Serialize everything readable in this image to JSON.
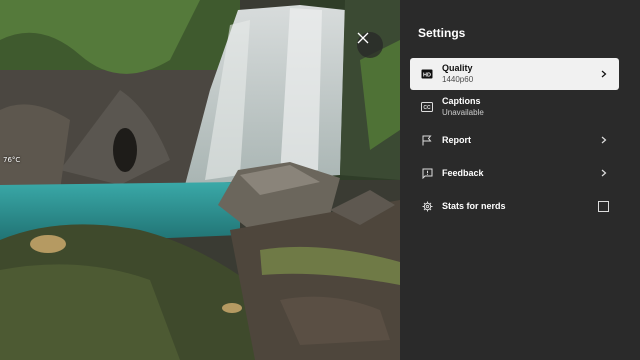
{
  "overlay": {
    "temperature": "76°C"
  },
  "settings": {
    "title": "Settings",
    "items": [
      {
        "label": "Quality",
        "sub": "1440p60",
        "icon": "hd-icon",
        "control": "chevron"
      },
      {
        "label": "Captions",
        "sub": "Unavailable",
        "icon": "closed-captions-icon",
        "control": "none"
      },
      {
        "label": "Report",
        "sub": "",
        "icon": "flag-icon",
        "control": "chevron"
      },
      {
        "label": "Feedback",
        "sub": "",
        "icon": "feedback-icon",
        "control": "chevron"
      },
      {
        "label": "Stats for nerds",
        "sub": "",
        "icon": "gear-icon",
        "control": "checkbox",
        "checked": false
      }
    ]
  },
  "colors": {
    "panel": "#2a2a2a",
    "active_item": "#f1f1f1",
    "water": "#2e9a9a"
  }
}
